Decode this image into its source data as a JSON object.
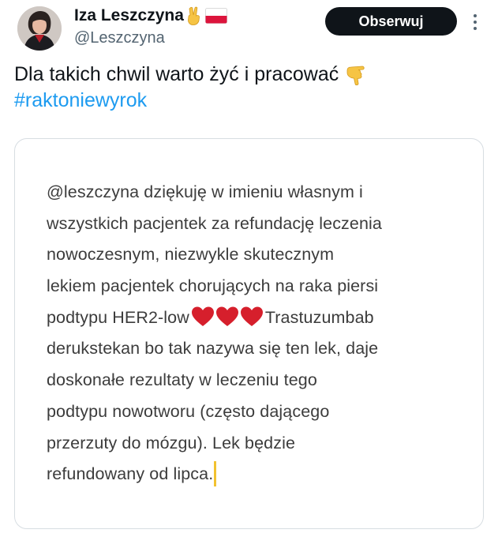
{
  "author": {
    "display_name": "Iza Leszczyna",
    "handle": "@Leszczyna",
    "name_emojis": [
      "victory-hand",
      "flag-poland"
    ]
  },
  "header": {
    "follow_label": "Obserwuj"
  },
  "tweet": {
    "text": "Dla takich chwil warto żyć i pracować",
    "text_emoji": "backhand-index-pointing-down",
    "hashtag": "#raktoniewyrok"
  },
  "media": {
    "lines": [
      "@leszczyna dziękuję w imieniu własnym i",
      "wszystkich pacjentek za refundację leczenia",
      "nowoczesnym, niezwykle skutecznym",
      "lekiem pacjentek chorujących na raka piersi"
    ],
    "line5_before": "podtypu HER2-low",
    "line5_after": "Trastuzumbab",
    "hearts_count": 3,
    "lines_after": [
      "derukstekan bo tak nazywa się ten lek, daje",
      "doskonałe rezultaty w leczeniu tego",
      "podtypu nowotworu (często dającego",
      "przerzuty do mózgu). Lek będzie"
    ],
    "last_line": "refundowany od lipca."
  },
  "colors": {
    "accent": "#1d9bf0",
    "text_primary": "#0f1419",
    "text_secondary": "#536471",
    "heart": "#d61f2c",
    "cursor": "#f2c230"
  }
}
